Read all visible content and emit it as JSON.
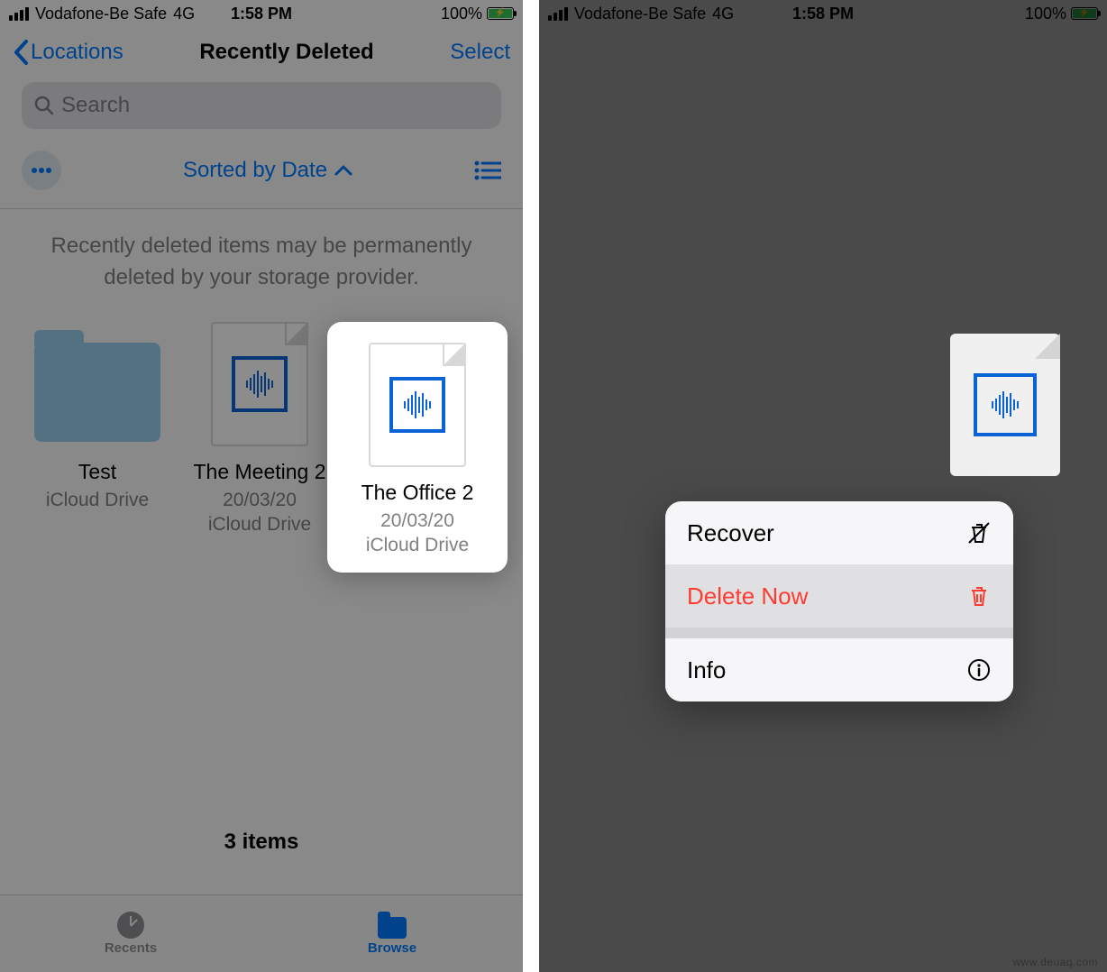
{
  "status": {
    "carrier": "Vodafone-Be Safe",
    "network": "4G",
    "time": "1:58 PM",
    "battery": "100%"
  },
  "nav": {
    "back_label": "Locations",
    "title": "Recently Deleted",
    "select_label": "Select"
  },
  "search": {
    "placeholder": "Search"
  },
  "toolbar": {
    "sort_label": "Sorted by Date"
  },
  "notice": "Recently deleted items may be permanently deleted by your storage provider.",
  "items": [
    {
      "name": "Test",
      "date": "",
      "location": "iCloud Drive"
    },
    {
      "name": "The Meeting 2",
      "date": "20/03/20",
      "location": "iCloud Drive"
    },
    {
      "name": "The Office 2",
      "date": "20/03/20",
      "location": "iCloud Drive"
    }
  ],
  "count": "3 items",
  "tabs": {
    "recents": "Recents",
    "browse": "Browse"
  },
  "menu": {
    "recover": "Recover",
    "delete": "Delete Now",
    "info": "Info"
  },
  "watermark": "www.deuaq.com"
}
